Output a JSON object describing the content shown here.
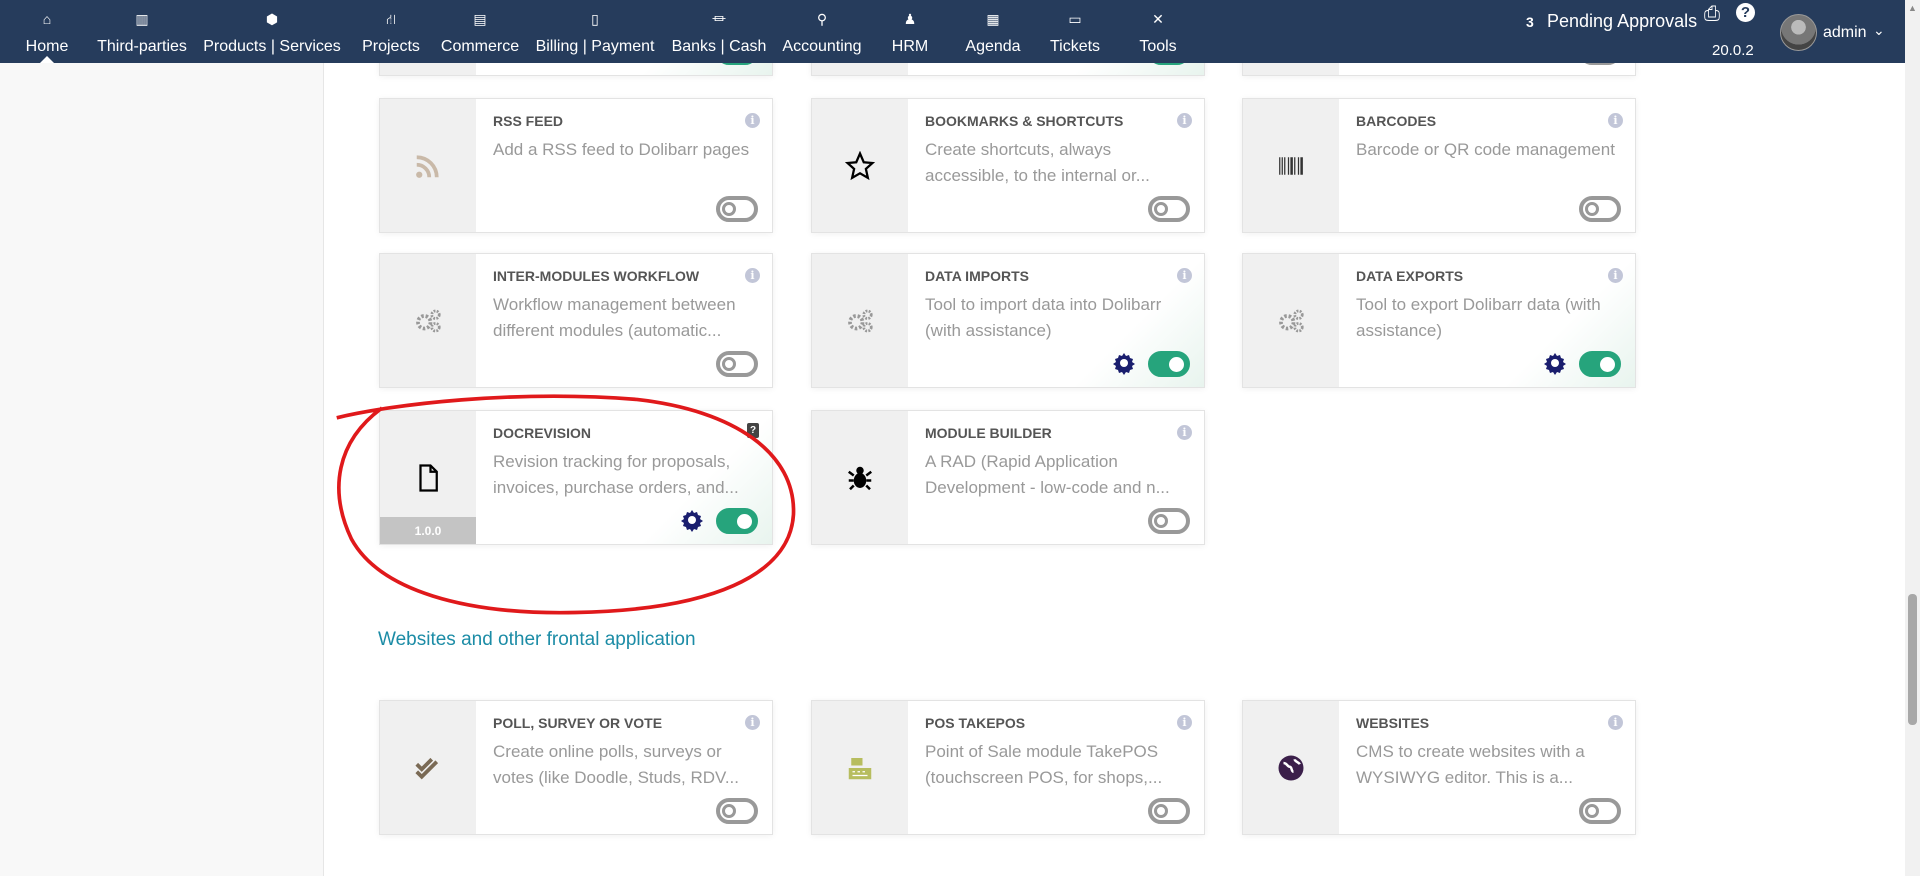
{
  "nav": {
    "items": [
      {
        "label": "Home",
        "icon": "home-icon"
      },
      {
        "label": "Third-parties",
        "icon": "building-icon"
      },
      {
        "label": "Products | Services",
        "icon": "cube-icon"
      },
      {
        "label": "Projects",
        "icon": "sitemap-icon"
      },
      {
        "label": "Commerce",
        "icon": "suitcase-icon"
      },
      {
        "label": "Billing | Payment",
        "icon": "invoice-icon"
      },
      {
        "label": "Banks | Cash",
        "icon": "bank-icon"
      },
      {
        "label": "Accounting",
        "icon": "search-dollar-icon"
      },
      {
        "label": "HRM",
        "icon": "user-tie-icon"
      },
      {
        "label": "Agenda",
        "icon": "calendar-icon"
      },
      {
        "label": "Tickets",
        "icon": "ticket-icon"
      },
      {
        "label": "Tools",
        "icon": "tools-icon"
      }
    ],
    "pending_count": "3",
    "pending_label": "Pending Approvals",
    "version": "20.0.2",
    "user": "admin"
  },
  "section_title": "Websites and other frontal application",
  "cards": [
    {
      "title": "RSS FEED",
      "desc": "Add a RSS feed to Dolibarr pages",
      "enabled": false,
      "icon": "rss-icon"
    },
    {
      "title": "BOOKMARKS & SHORTCUTS",
      "desc": "Create shortcuts, always accessible, to the internal or...",
      "enabled": false,
      "icon": "star-icon"
    },
    {
      "title": "BARCODES",
      "desc": "Barcode or QR code management",
      "enabled": false,
      "icon": "barcode-icon"
    },
    {
      "title": "INTER-MODULES WORKFLOW",
      "desc": "Workflow management between different modules (automatic...",
      "enabled": false,
      "icon": "cogs-icon"
    },
    {
      "title": "DATA IMPORTS",
      "desc": "Tool to import data into Dolibarr (with assistance)",
      "enabled": true,
      "icon": "cogs-icon"
    },
    {
      "title": "DATA EXPORTS",
      "desc": "Tool to export Dolibarr data (with assistance)",
      "enabled": true,
      "icon": "cogs-icon"
    },
    {
      "title": "DOCREVISION",
      "desc": "Revision tracking for proposals, invoices, purchase orders, and...",
      "enabled": true,
      "icon": "file-icon",
      "version": "1.0.0"
    },
    {
      "title": "MODULE BUILDER",
      "desc": "A RAD (Rapid Application Development - low-code and n...",
      "enabled": false,
      "icon": "bug-icon"
    },
    {
      "title": "POLL, SURVEY OR VOTE",
      "desc": "Create online polls, surveys or votes (like Doodle, Studs, RDV...",
      "enabled": false,
      "icon": "check-double-icon"
    },
    {
      "title": "POS TAKEPOS",
      "desc": "Point of Sale module TakePOS (touchscreen POS, for shops,...",
      "enabled": false,
      "icon": "cash-register-icon"
    },
    {
      "title": "WEBSITES",
      "desc": "CMS to create websites with a WYSIWYG editor. This is a...",
      "enabled": false,
      "icon": "globe-icon"
    }
  ],
  "colors": {
    "nav": "#263c5c",
    "toggle_on": "#26a47c",
    "section": "#1c8ca6",
    "annotation": "#e0191b"
  }
}
